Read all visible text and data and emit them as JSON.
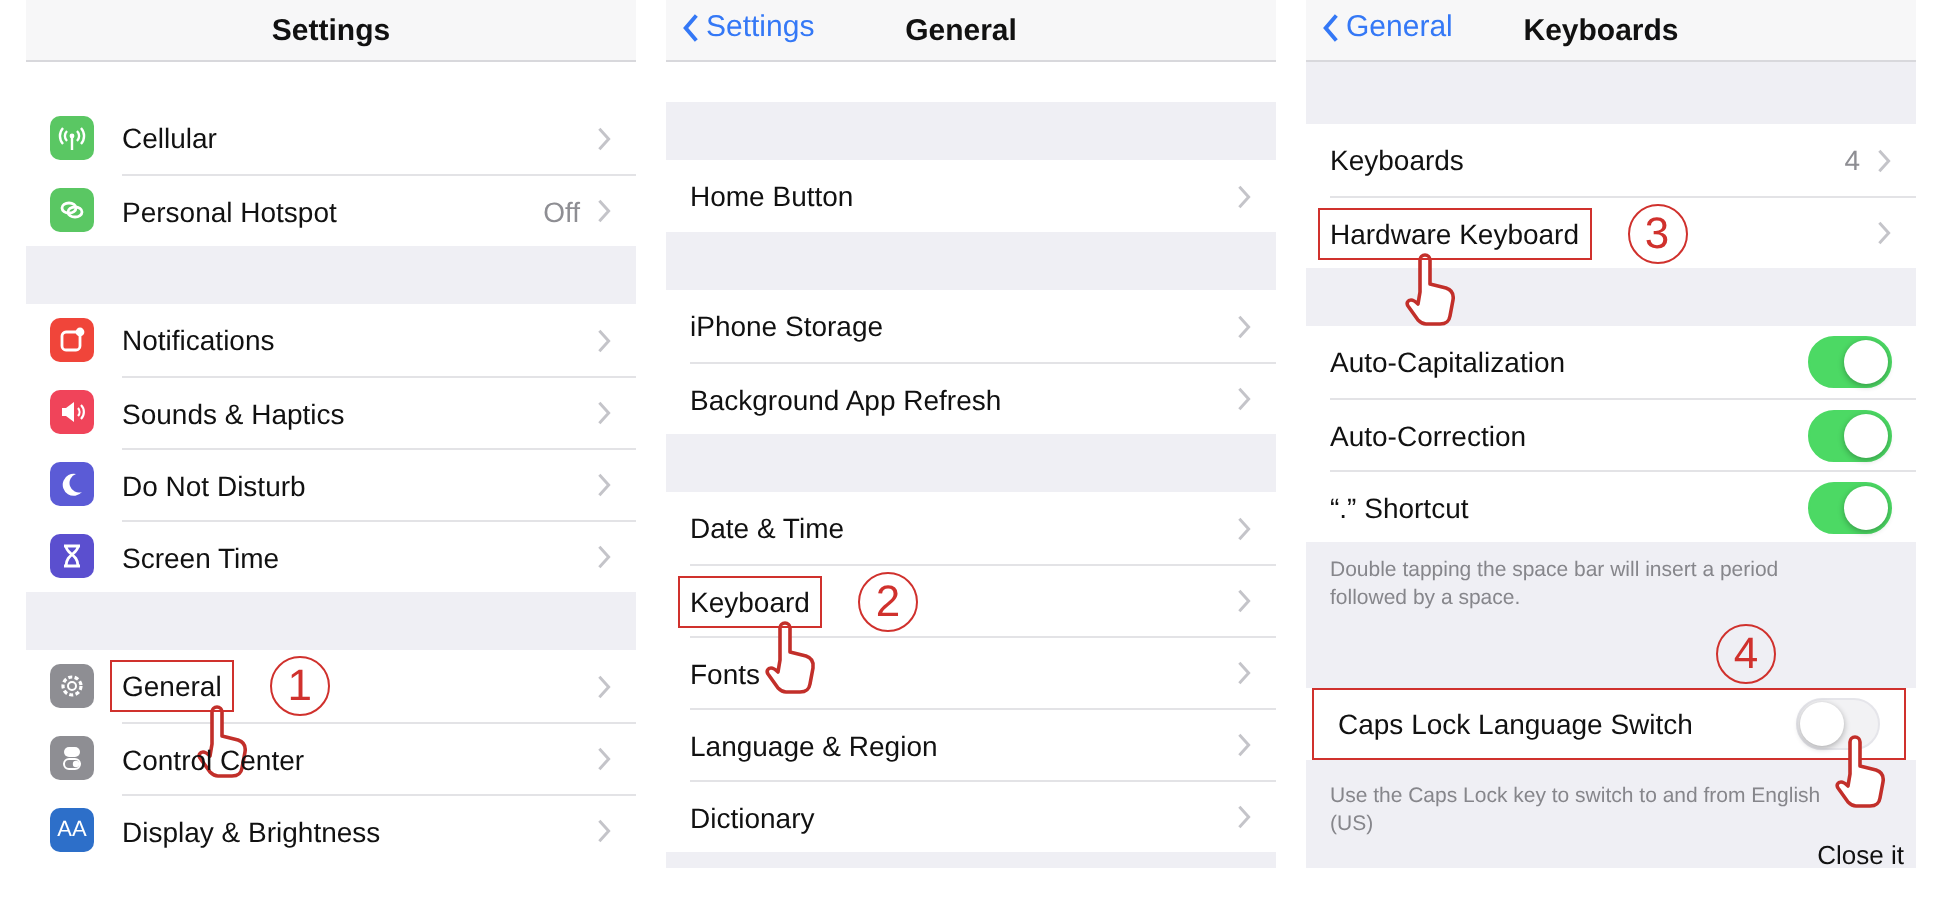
{
  "panels": [
    {
      "title": "Settings",
      "groups": [
        {
          "rows": [
            {
              "kind": "link",
              "label": "Cellular",
              "color": "#5ac763"
            },
            {
              "kind": "link",
              "label": "Personal Hotspot",
              "value": "Off",
              "color": "#5ac763"
            }
          ]
        },
        {
          "rows": [
            {
              "kind": "link",
              "label": "Notifications",
              "color": "#f0453a"
            },
            {
              "kind": "link",
              "label": "Sounds & Haptics",
              "color": "#f0445a"
            },
            {
              "kind": "link",
              "label": "Do Not Disturb",
              "color": "#5b5bd6"
            },
            {
              "kind": "link",
              "label": "Screen Time",
              "color": "#5b4fcf"
            }
          ]
        },
        {
          "rows": [
            {
              "kind": "link",
              "label": "General",
              "color": "#8e8e93",
              "label_boxed": true,
              "step": "1"
            },
            {
              "kind": "link",
              "label": "Control Center",
              "color": "#8e8e93"
            },
            {
              "kind": "link",
              "label": "Display & Brightness",
              "color": "#2d6fc9",
              "icon_text": "AA"
            }
          ]
        }
      ]
    },
    {
      "title": "General",
      "back": "Settings",
      "groups": [
        {
          "rows": [
            {
              "kind": "link",
              "label": "Home Button"
            }
          ]
        },
        {
          "rows": [
            {
              "kind": "link",
              "label": "iPhone Storage"
            },
            {
              "kind": "link",
              "label": "Background App Refresh"
            }
          ]
        },
        {
          "rows": [
            {
              "kind": "link",
              "label": "Date & Time"
            },
            {
              "kind": "link",
              "label": "Keyboard",
              "label_boxed": true,
              "step": "2"
            },
            {
              "kind": "link",
              "label": "Fonts"
            },
            {
              "kind": "link",
              "label": "Language & Region"
            },
            {
              "kind": "link",
              "label": "Dictionary"
            }
          ]
        }
      ]
    },
    {
      "title": "Keyboards",
      "back": "General",
      "groups": [
        {
          "rows": [
            {
              "kind": "link",
              "label": "Keyboards",
              "value": "4"
            },
            {
              "kind": "link",
              "label": "Hardware Keyboard",
              "label_boxed": true,
              "step": "3"
            }
          ]
        },
        {
          "rows": [
            {
              "kind": "toggle",
              "label": "Auto-Capitalization",
              "on": true
            },
            {
              "kind": "toggle",
              "label": "Auto-Correction",
              "on": true
            },
            {
              "kind": "toggle",
              "label": "“.” Shortcut",
              "on": true
            }
          ],
          "footer": "Double tapping the space bar will insert a period followed by a space."
        },
        {
          "rows": [
            {
              "kind": "toggle",
              "label": "Caps Lock Language Switch",
              "on": false,
              "row_boxed": true,
              "step": "4"
            }
          ],
          "footer": "Use the Caps Lock key to switch to and from English (US)",
          "note": "Close it"
        }
      ]
    }
  ]
}
